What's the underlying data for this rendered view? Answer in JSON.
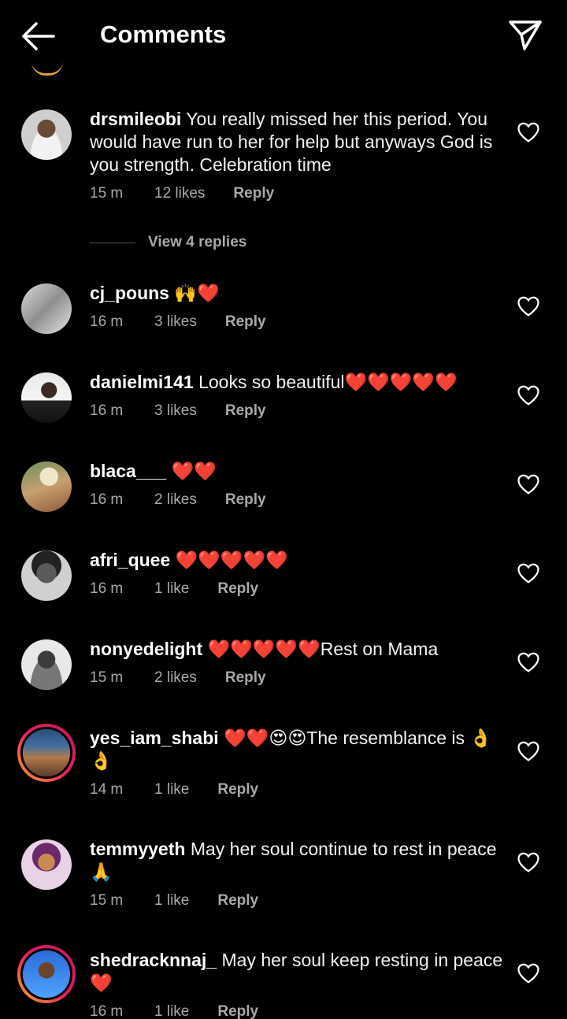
{
  "header": {
    "title": "Comments"
  },
  "comments": [
    {
      "username": "drsmileobi",
      "text": "You really missed her this period. You would have run to her for help but anyways God is you strength. Celebration time",
      "time": "15 m",
      "likes": "12 likes",
      "reply": "Reply",
      "view_replies": "View 4 replies"
    },
    {
      "username": "cj_pouns",
      "text": "🙌❤️",
      "time": "16 m",
      "likes": "3 likes",
      "reply": "Reply"
    },
    {
      "username": "danielmi141",
      "text": "Looks so beautiful❤️❤️❤️❤️❤️",
      "time": "16 m",
      "likes": "3 likes",
      "reply": "Reply"
    },
    {
      "username": "blaca___",
      "text": "❤️❤️",
      "time": "16 m",
      "likes": "2 likes",
      "reply": "Reply"
    },
    {
      "username": "afri_quee",
      "text": "❤️❤️❤️❤️❤️",
      "time": "16 m",
      "likes": "1 like",
      "reply": "Reply"
    },
    {
      "username": "nonyedelight",
      "text": "❤️❤️❤️❤️❤️Rest on Mama",
      "time": "15 m",
      "likes": "2 likes",
      "reply": "Reply"
    },
    {
      "username": "yes_iam_shabi",
      "text": "❤️❤️😍😍The resemblance is 👌👌",
      "time": "14 m",
      "likes": "1 like",
      "reply": "Reply"
    },
    {
      "username": "temmyyeth",
      "text": "May her soul continue to rest in peace 🙏",
      "time": "15 m",
      "likes": "1 like",
      "reply": "Reply"
    },
    {
      "username": "shedracknnaj_",
      "text": "May her soul keep resting in peace ❤️",
      "time": "16 m",
      "likes": "1 like",
      "reply": "Reply"
    }
  ],
  "icons": {
    "back": "arrow-left-icon",
    "send": "paper-plane-icon",
    "like": "heart-outline-icon"
  },
  "colors": {
    "background": "#000000",
    "text": "#ffffff",
    "meta": "#a8a8a8",
    "story_ring_start": "#f9a825",
    "story_ring_end": "#c2185b"
  }
}
